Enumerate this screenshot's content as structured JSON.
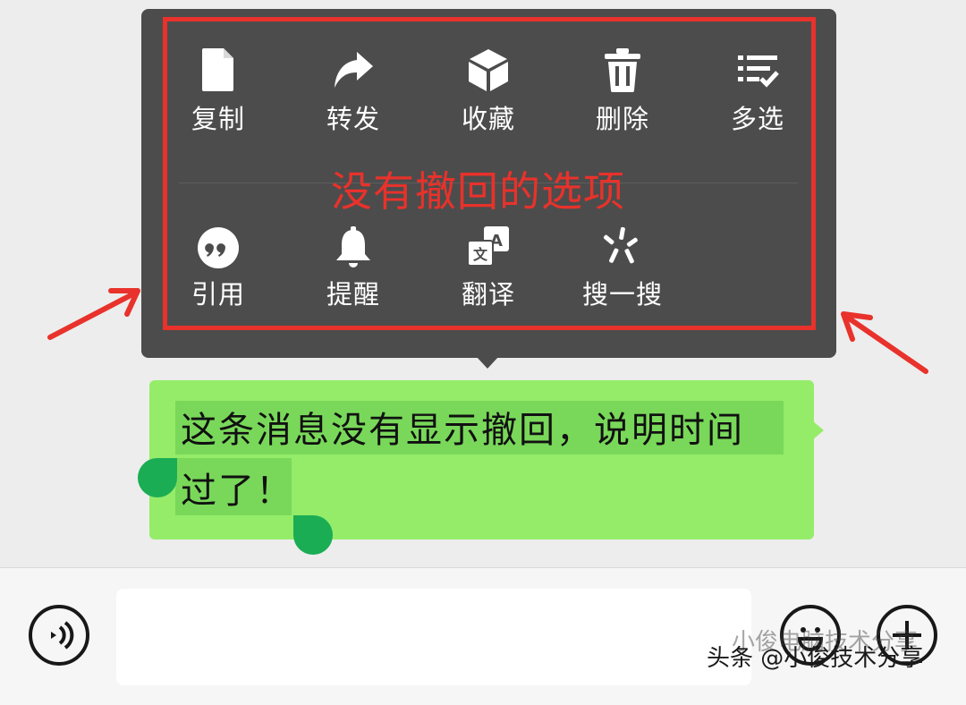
{
  "context_menu": {
    "row1": [
      {
        "label": "复制",
        "icon": "copy-icon"
      },
      {
        "label": "转发",
        "icon": "forward-icon"
      },
      {
        "label": "收藏",
        "icon": "favorite-icon"
      },
      {
        "label": "删除",
        "icon": "trash-icon"
      },
      {
        "label": "多选",
        "icon": "multiselect-icon"
      }
    ],
    "row2": [
      {
        "label": "引用",
        "icon": "quote-icon"
      },
      {
        "label": "提醒",
        "icon": "bell-icon"
      },
      {
        "label": "翻译",
        "icon": "translate-icon"
      },
      {
        "label": "搜一搜",
        "icon": "search-sparkle-icon"
      }
    ]
  },
  "annotation": {
    "note": "没有撤回的选项",
    "color": "#e8322b"
  },
  "message": {
    "line1": "这条消息没有显示撤回，说明时间",
    "line2": "过了！",
    "bubble_color": "#95ec69"
  },
  "input_bar": {
    "voice_icon": "voice-icon",
    "emoji_icon": "emoji-icon",
    "plus_icon": "plus-icon"
  },
  "watermark": {
    "overlay_text": "头条 @小俊技术分享",
    "ghost_text": "小俊电脑技术分享"
  }
}
